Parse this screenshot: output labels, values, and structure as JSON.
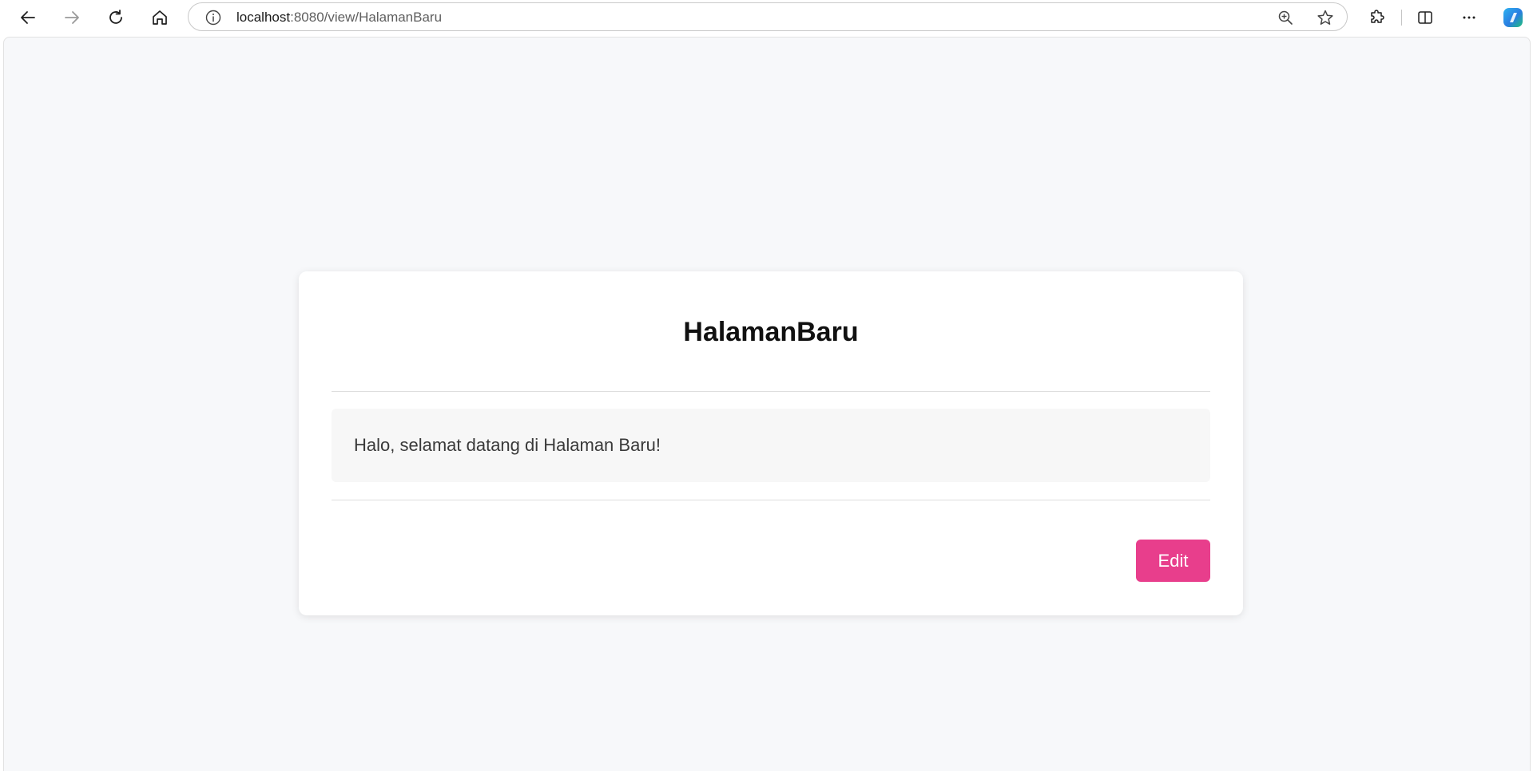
{
  "browser": {
    "url_host": "localhost",
    "url_rest": ":8080/view/HalamanBaru",
    "icons": [
      "back-icon",
      "forward-icon",
      "refresh-icon",
      "home-icon",
      "info-icon",
      "zoom-icon",
      "favorite-star-icon",
      "extensions-icon",
      "split-screen-icon",
      "more-icon",
      "copilot-icon"
    ]
  },
  "page": {
    "title": "HalamanBaru",
    "content": "Halo, selamat datang di Halaman Baru!",
    "edit_label": "Edit"
  },
  "colors": {
    "accent": "#e83e8c",
    "page_background": "#f7f8fa",
    "card_background": "#ffffff",
    "content_background": "#f7f7f7"
  }
}
